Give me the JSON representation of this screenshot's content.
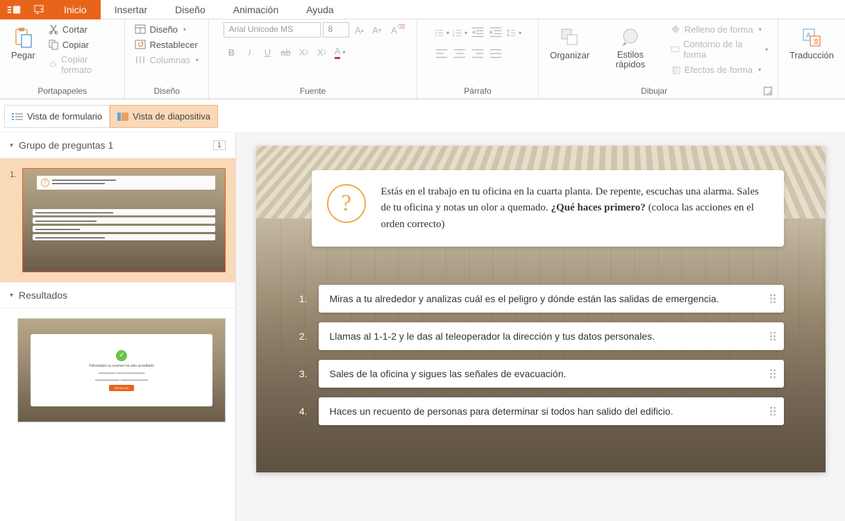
{
  "tabs": {
    "inicio": "Inicio",
    "insertar": "Insertar",
    "diseno": "Diseño",
    "animacion": "Animación",
    "ayuda": "Ayuda"
  },
  "ribbon": {
    "clipboard": {
      "paste": "Pegar",
      "cut": "Cortar",
      "copy": "Copiar",
      "format": "Copiar formato",
      "label": "Portapapeles"
    },
    "design": {
      "design": "Diseño",
      "reset": "Restablecer",
      "columns": "Columnas",
      "label": "Diseño"
    },
    "font": {
      "family": "Arial Unicode MS",
      "size": "8",
      "label": "Fuente"
    },
    "paragraph": {
      "label": "Párrafo"
    },
    "draw": {
      "arrange": "Organizar",
      "quick": "Estilos rápidos",
      "fill": "Relleno de forma",
      "outline": "Contorno de la forma",
      "effects": "Efectos de forma",
      "label": "Dibujar"
    },
    "translate": {
      "label": "Traducción"
    }
  },
  "views": {
    "form": "Vista de formulario",
    "slide": "Vista de diapositiva"
  },
  "sidebar": {
    "group_label": "Grupo de preguntas 1",
    "group_count": "1",
    "results_label": "Resultados",
    "thumb1_num": "1.",
    "results_thumb": {
      "title": "Felicidades su examen ha sido acreditado",
      "btn": "DETALLES"
    }
  },
  "slide": {
    "question_pre": "Estás en el trabajo en tu oficina en la cuarta planta. De repente, escuchas una alarma. Sales de tu oficina y notas un olor a quemado. ",
    "question_bold": "¿Qué haces primero?",
    "question_post": " (coloca las acciones en el orden correcto)",
    "answers": [
      {
        "n": "1.",
        "text": "Miras a tu alrededor y analizas cuál es el peligro y dónde están las salidas de emergencia."
      },
      {
        "n": "2.",
        "text": "Llamas al 1-1-2 y le das al teleoperador la dirección y tus datos personales."
      },
      {
        "n": "3.",
        "text": "Sales de la oficina y sigues las señales de evacuación."
      },
      {
        "n": "4.",
        "text": "Haces un recuento de personas para determinar si todos han salido del edificio."
      }
    ]
  }
}
